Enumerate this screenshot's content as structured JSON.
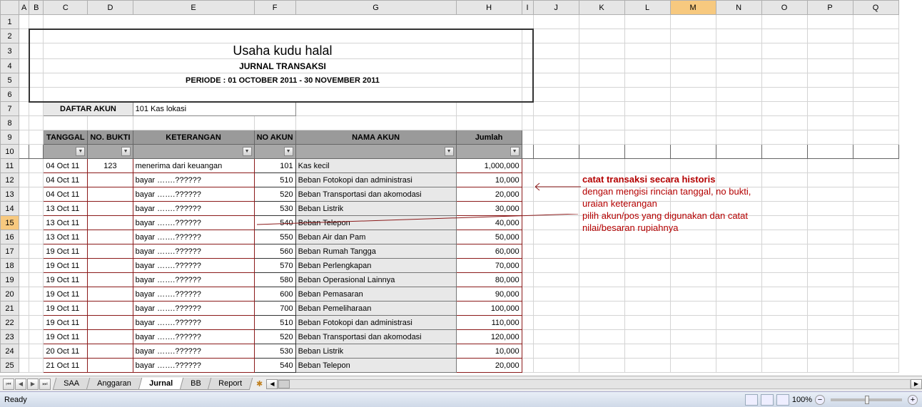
{
  "columns": [
    "A",
    "B",
    "C",
    "D",
    "E",
    "F",
    "G",
    "H",
    "I",
    "J",
    "K",
    "L",
    "M",
    "N",
    "O",
    "P",
    "Q"
  ],
  "rows_visible": 25,
  "title": {
    "line1": "Usaha kudu halal",
    "line2": "JURNAL TRANSAKSI",
    "line3": "PERIODE : 01 OCTOBER 2011 - 30 NOVEMBER 2011"
  },
  "daftar": {
    "label": "DAFTAR AKUN",
    "value": "101  Kas lokasi"
  },
  "headers": {
    "tanggal": "TANGGAL",
    "nobukti": "NO. BUKTI",
    "keterangan": "KETERANGAN",
    "noakun": "NO AKUN",
    "namaakun": "NAMA AKUN",
    "jumlah": "Jumlah"
  },
  "rows": [
    {
      "tgl": "04 Oct 11",
      "bukti": "123",
      "ket": "menerima dari keuangan",
      "no": "101",
      "nama": "Kas kecil",
      "jml": "1,000,000"
    },
    {
      "tgl": "04 Oct 11",
      "bukti": "",
      "ket": "bayar …….??????",
      "no": "510",
      "nama": "Beban Fotokopi dan administrasi",
      "jml": "10,000"
    },
    {
      "tgl": "04 Oct 11",
      "bukti": "",
      "ket": "bayar …….??????",
      "no": "520",
      "nama": "Beban Transportasi dan akomodasi",
      "jml": "20,000"
    },
    {
      "tgl": "13 Oct 11",
      "bukti": "",
      "ket": "bayar …….??????",
      "no": "530",
      "nama": "Beban Listrik",
      "jml": "30,000"
    },
    {
      "tgl": "13 Oct 11",
      "bukti": "",
      "ket": "bayar …….??????",
      "no": "540",
      "nama": "Beban Telepon",
      "jml": "40,000"
    },
    {
      "tgl": "13 Oct 11",
      "bukti": "",
      "ket": "bayar …….??????",
      "no": "550",
      "nama": "Beban Air dan Pam",
      "jml": "50,000"
    },
    {
      "tgl": "19 Oct 11",
      "bukti": "",
      "ket": "bayar …….??????",
      "no": "560",
      "nama": "Beban Rumah Tangga",
      "jml": "60,000"
    },
    {
      "tgl": "19 Oct 11",
      "bukti": "",
      "ket": "bayar …….??????",
      "no": "570",
      "nama": "Beban Perlengkapan",
      "jml": "70,000"
    },
    {
      "tgl": "19 Oct 11",
      "bukti": "",
      "ket": "bayar …….??????",
      "no": "580",
      "nama": "Beban Operasional Lainnya",
      "jml": "80,000"
    },
    {
      "tgl": "19 Oct 11",
      "bukti": "",
      "ket": "bayar …….??????",
      "no": "600",
      "nama": "Beban Pemasaran",
      "jml": "90,000"
    },
    {
      "tgl": "19 Oct 11",
      "bukti": "",
      "ket": "bayar …….??????",
      "no": "700",
      "nama": "Beban Pemeliharaan",
      "jml": "100,000"
    },
    {
      "tgl": "19 Oct 11",
      "bukti": "",
      "ket": "bayar …….??????",
      "no": "510",
      "nama": "Beban Fotokopi dan administrasi",
      "jml": "110,000"
    },
    {
      "tgl": "19 Oct 11",
      "bukti": "",
      "ket": "bayar …….??????",
      "no": "520",
      "nama": "Beban Transportasi dan akomodasi",
      "jml": "120,000"
    },
    {
      "tgl": "20 Oct 11",
      "bukti": "",
      "ket": "bayar …….??????",
      "no": "530",
      "nama": "Beban Listrik",
      "jml": "10,000"
    },
    {
      "tgl": "21 Oct 11",
      "bukti": "",
      "ket": "bayar …….??????",
      "no": "540",
      "nama": "Beban Telepon",
      "jml": "20,000"
    }
  ],
  "note": {
    "l1": "catat transaksi secara historis",
    "l2": "dengan mengisi rincian tanggal, no bukti,",
    "l3": "uraian keterangan",
    "l4": "pilih akun/pos yang digunakan dan catat",
    "l5": "nilai/besaran rupiahnya"
  },
  "sheets": {
    "s1": "SAA",
    "s2": "Anggaran",
    "s3": "Jurnal",
    "s4": "BB",
    "s5": "Report"
  },
  "status": {
    "ready": "Ready",
    "zoom": "100%"
  },
  "selected_column": "M",
  "selected_row": "15"
}
